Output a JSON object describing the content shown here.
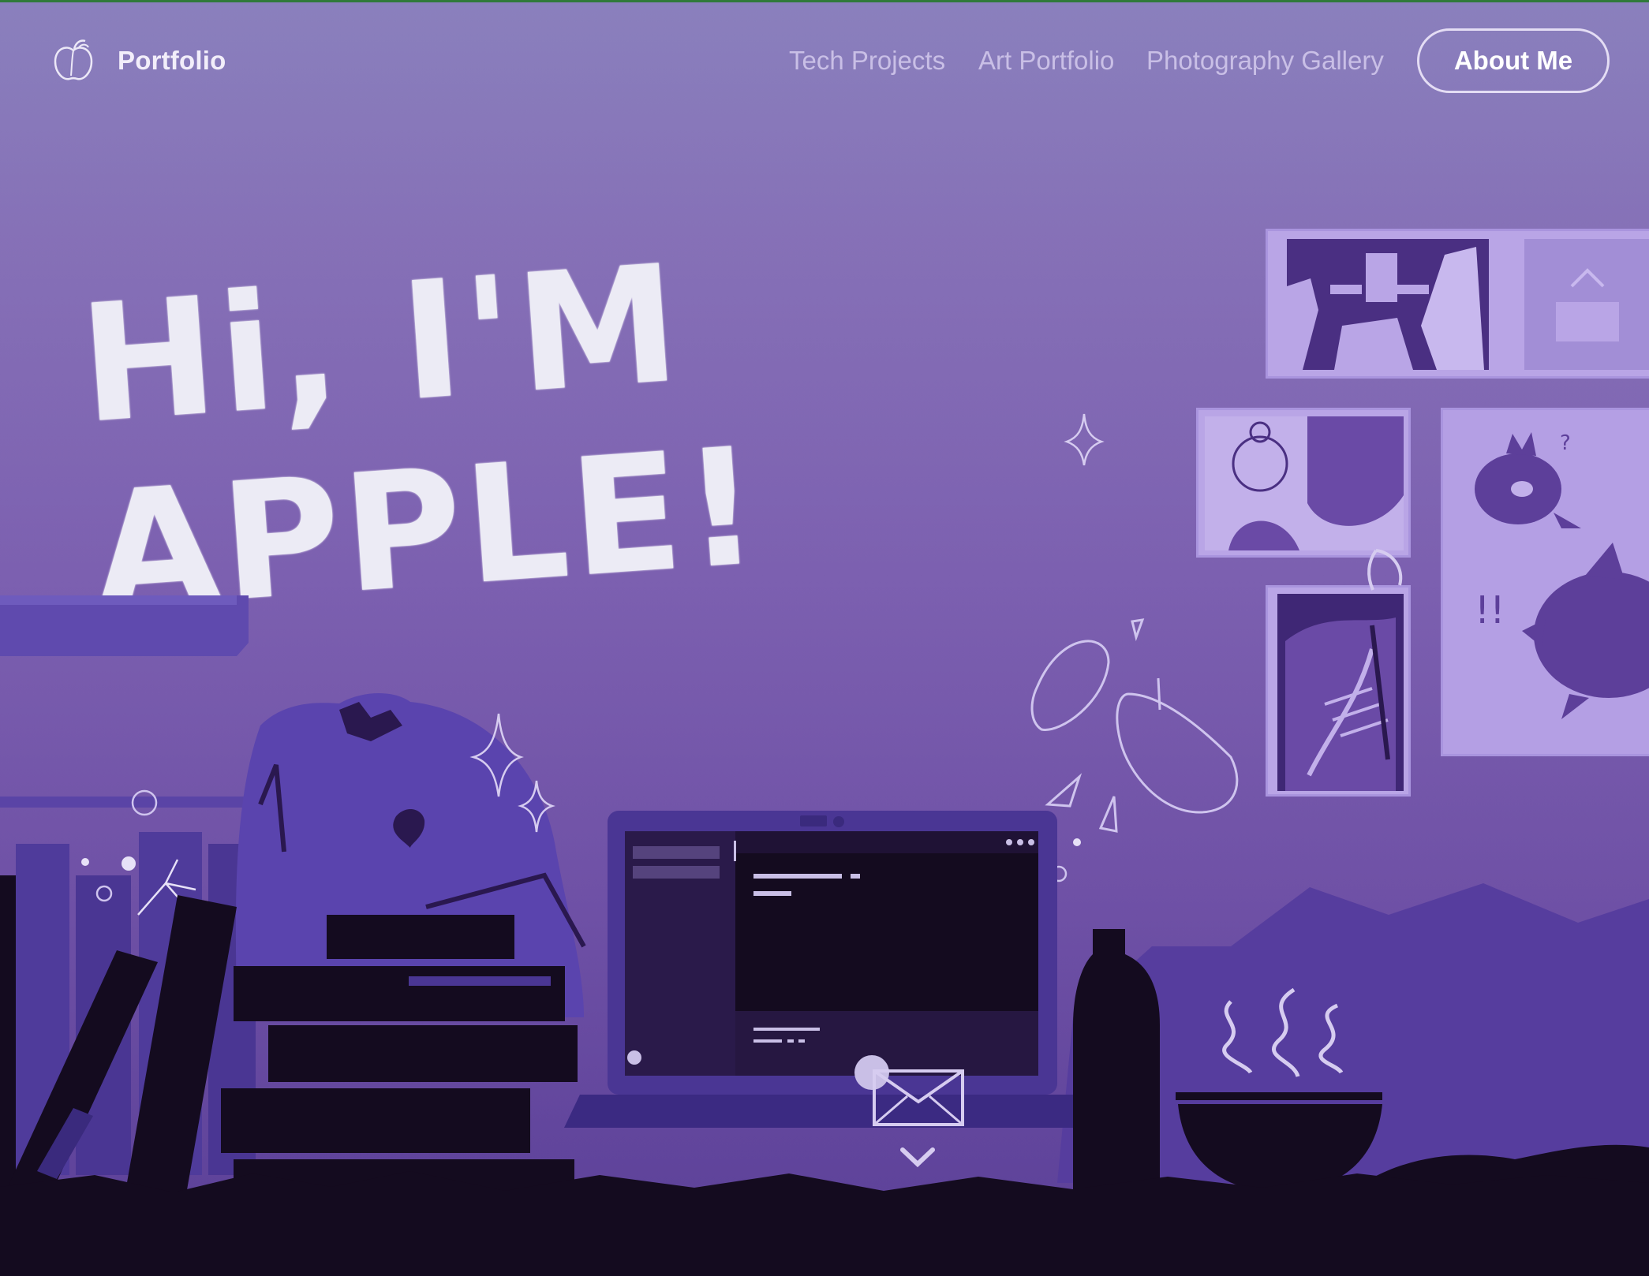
{
  "nav": {
    "brand": "Portfolio",
    "links": [
      "Tech Projects",
      "Art Portfolio",
      "Photography Gallery"
    ],
    "cta": "About Me"
  },
  "hero": {
    "title": "Hi, I'M APPLE!"
  },
  "scene": {
    "annotations": [
      "?",
      "!!"
    ]
  },
  "icons": {
    "logo": "apple-outline-icon",
    "contact": "envelope-icon",
    "scroll": "chevron-down-icon"
  },
  "colors": {
    "accent_dark": "#140b1f",
    "frame_fill": "#b9a5e6",
    "title_text": "#ecebf5"
  }
}
